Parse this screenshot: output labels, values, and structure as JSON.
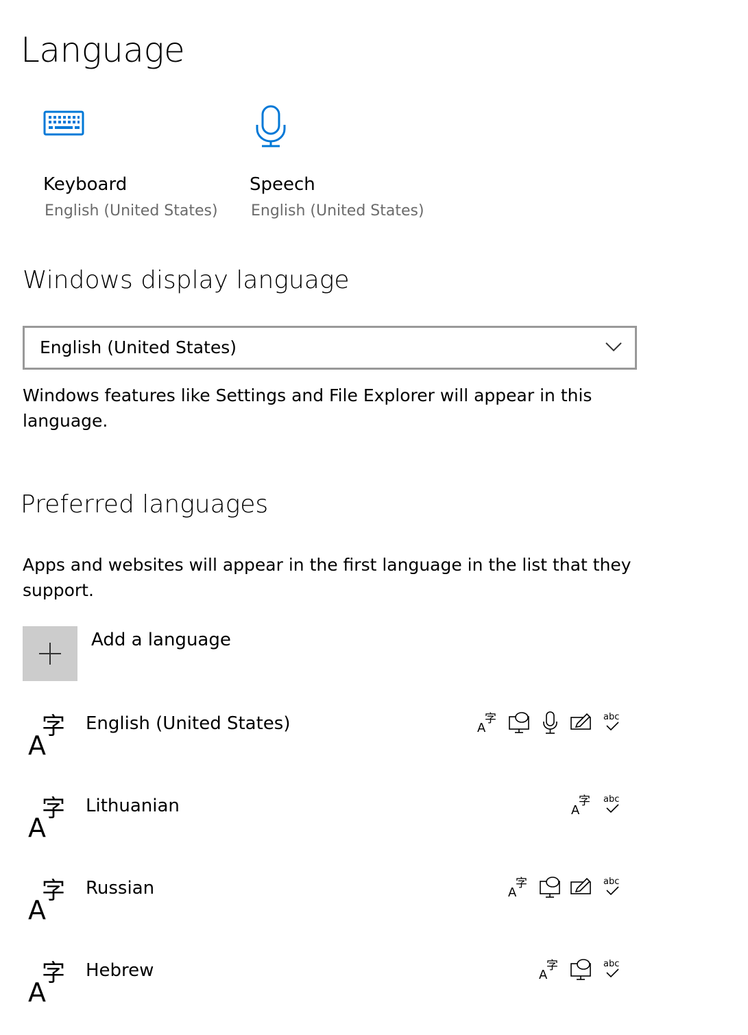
{
  "page": {
    "title": "Language"
  },
  "tiles": [
    {
      "title": "Keyboard",
      "subtitle": "English (United States)",
      "icon": "keyboard-icon"
    },
    {
      "title": "Speech",
      "subtitle": "English (United States)",
      "icon": "microphone-icon"
    }
  ],
  "display_language": {
    "heading": "Windows display language",
    "selected": "English (United States)",
    "description": "Windows features like Settings and File Explorer will appear in this language."
  },
  "preferred": {
    "heading": "Preferred languages",
    "description": "Apps and websites will appear in the first language in the list that they support.",
    "add_label": "Add a language",
    "languages": [
      {
        "name": "English (United States)",
        "features": [
          "display-language-icon",
          "text-to-speech-icon",
          "speech-recognition-icon",
          "handwriting-icon",
          "spellcheck-icon"
        ]
      },
      {
        "name": "Lithuanian",
        "features": [
          "display-language-icon",
          "spellcheck-icon"
        ]
      },
      {
        "name": "Russian",
        "features": [
          "display-language-icon",
          "text-to-speech-icon",
          "handwriting-icon",
          "spellcheck-icon"
        ]
      },
      {
        "name": "Hebrew",
        "features": [
          "display-language-icon",
          "text-to-speech-icon",
          "spellcheck-icon"
        ]
      }
    ],
    "spellcheck_text": "abc"
  },
  "colors": {
    "accent": "#0078d7",
    "secondary_text": "#6b6b6b",
    "add_button_bg": "#cccccc"
  }
}
